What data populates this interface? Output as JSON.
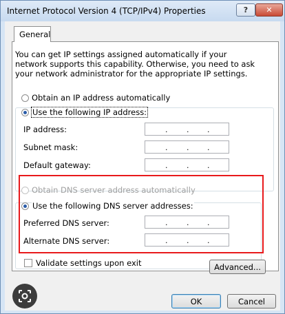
{
  "window": {
    "title": "Internet Protocol Version 4 (TCP/IPv4) Properties",
    "help_label": "?",
    "close_label": "✕"
  },
  "tabs": [
    {
      "label": "General",
      "selected": true
    }
  ],
  "description": "You can get IP settings assigned automatically if your network supports this capability. Otherwise, you need to ask your network administrator for the appropriate IP settings.",
  "ip_options": {
    "auto": {
      "label": "Obtain an IP address automatically",
      "selected": false
    },
    "manual": {
      "label": "Use the following IP address:",
      "selected": true
    }
  },
  "ip_fields": [
    {
      "label": "IP address:",
      "value": ""
    },
    {
      "label": "Subnet mask:",
      "value": ""
    },
    {
      "label": "Default gateway:",
      "value": ""
    }
  ],
  "dns_options": {
    "auto": {
      "label": "Obtain DNS server address automatically",
      "selected": false,
      "enabled": false
    },
    "manual": {
      "label": "Use the following DNS server addresses:",
      "selected": true
    }
  },
  "dns_fields": [
    {
      "label": "Preferred DNS server:",
      "value": ""
    },
    {
      "label": "Alternate DNS server:",
      "value": ""
    }
  ],
  "validate": {
    "label": "Validate settings upon exit",
    "checked": false
  },
  "buttons": {
    "advanced": "Advanced...",
    "ok": "OK",
    "cancel": "Cancel"
  },
  "colors": {
    "highlight": "#e8191b",
    "accent": "#2a5ca8"
  },
  "overlay_icon": "lens-icon"
}
